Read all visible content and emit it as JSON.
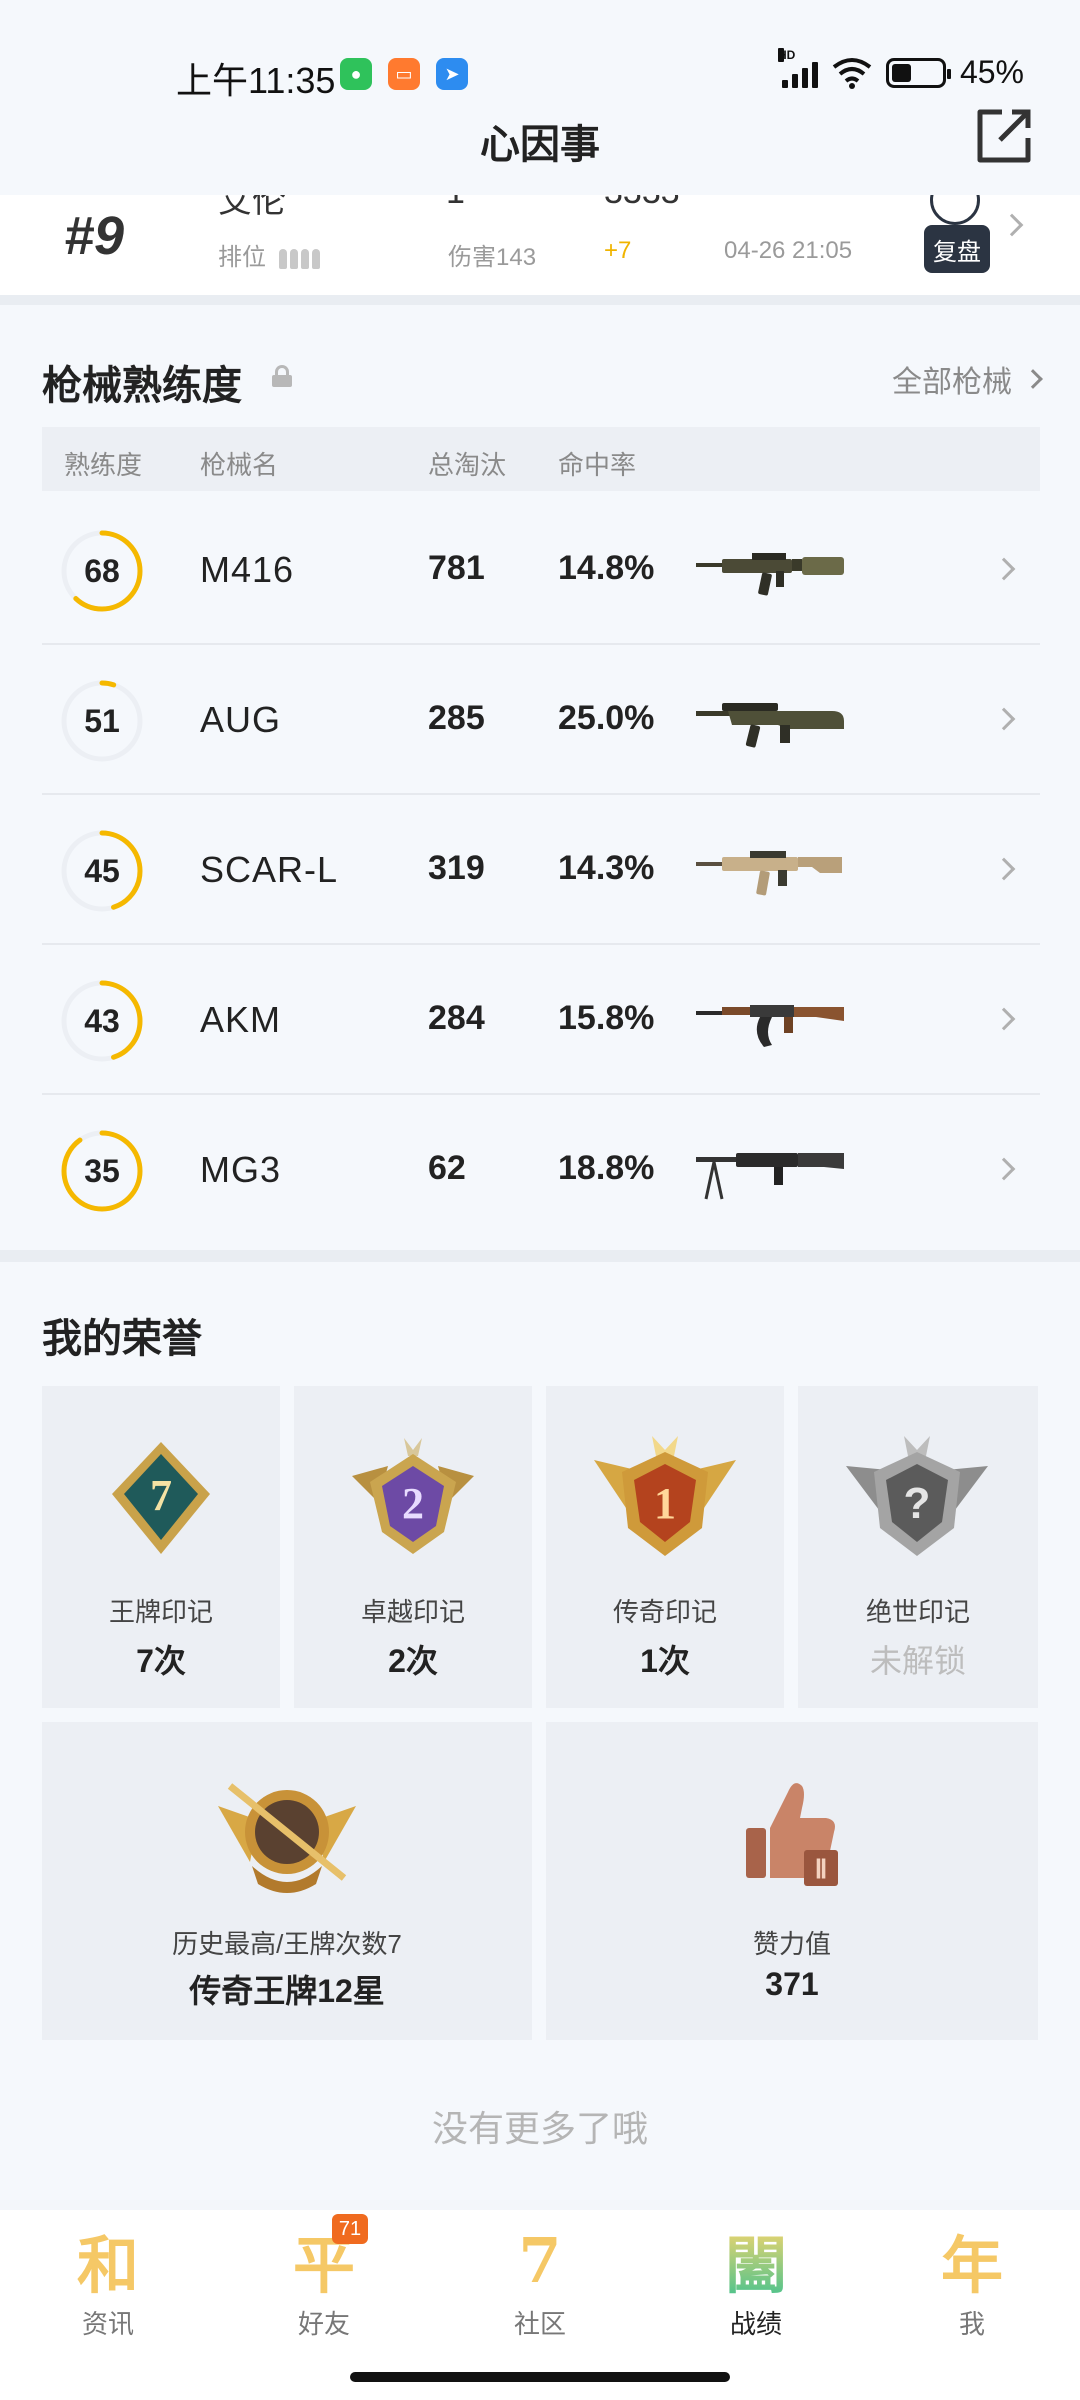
{
  "status_bar": {
    "time": "上午11:35",
    "battery": "45%",
    "network": "HD"
  },
  "header": {
    "title": "心因事"
  },
  "match": {
    "rank": "#9",
    "mode": "排位",
    "damage": "伤害143",
    "score_change": "+7",
    "datetime": "04-26 21:05",
    "replay_label": "复盘"
  },
  "weapons": {
    "title": "枪械熟练度",
    "all_label": "全部枪械",
    "columns": [
      "熟练度",
      "枪械名",
      "总淘汰",
      "命中率"
    ],
    "rows": [
      {
        "level": "68",
        "name": "M416",
        "kills": "781",
        "accuracy": "14.8%",
        "progress": 0.62,
        "icon": "m416-rifle-icon"
      },
      {
        "level": "51",
        "name": "AUG",
        "kills": "285",
        "accuracy": "25.0%",
        "progress": 0.05,
        "icon": "aug-rifle-icon"
      },
      {
        "level": "45",
        "name": "SCAR-L",
        "kills": "319",
        "accuracy": "14.3%",
        "progress": 0.45,
        "icon": "scar-l-rifle-icon"
      },
      {
        "level": "43",
        "name": "AKM",
        "kills": "284",
        "accuracy": "15.8%",
        "progress": 0.45,
        "icon": "akm-rifle-icon"
      },
      {
        "level": "35",
        "name": "MG3",
        "kills": "62",
        "accuracy": "18.8%",
        "progress": 0.9,
        "icon": "mg3-machine-gun-icon"
      }
    ]
  },
  "honors": {
    "title": "我的荣誉",
    "marks": [
      {
        "label": "王牌印记",
        "value": "7次",
        "badge_text": "7",
        "icon": "ace-mark-badge-icon"
      },
      {
        "label": "卓越印记",
        "value": "2次",
        "badge_text": "2",
        "icon": "excellent-mark-badge-icon"
      },
      {
        "label": "传奇印记",
        "value": "1次",
        "badge_text": "1",
        "icon": "legend-mark-badge-icon"
      },
      {
        "label": "绝世印记",
        "value": "未解锁",
        "badge_text": "?",
        "icon": "peerless-mark-badge-icon"
      }
    ],
    "best": {
      "label": "历史最高/王牌次数7",
      "value": "传奇王牌12星",
      "icon": "legend-ace-badge-icon"
    },
    "likes": {
      "label": "赞力值",
      "value": "371",
      "icon": "thumbs-up-icon"
    }
  },
  "footer_text": "没有更多了哦",
  "nav": [
    {
      "icon_char": "和",
      "label": "资讯"
    },
    {
      "icon_char": "平",
      "label": "好友",
      "badge": "71"
    },
    {
      "icon_char": "7",
      "label": "社区"
    },
    {
      "icon_char": "闔",
      "label": "战绩",
      "active": true
    },
    {
      "icon_char": "年",
      "label": "我"
    }
  ],
  "colors": {
    "accent": "#f5b800",
    "ring_track": "#eceff4",
    "nav_badge": "#f06b1f"
  }
}
